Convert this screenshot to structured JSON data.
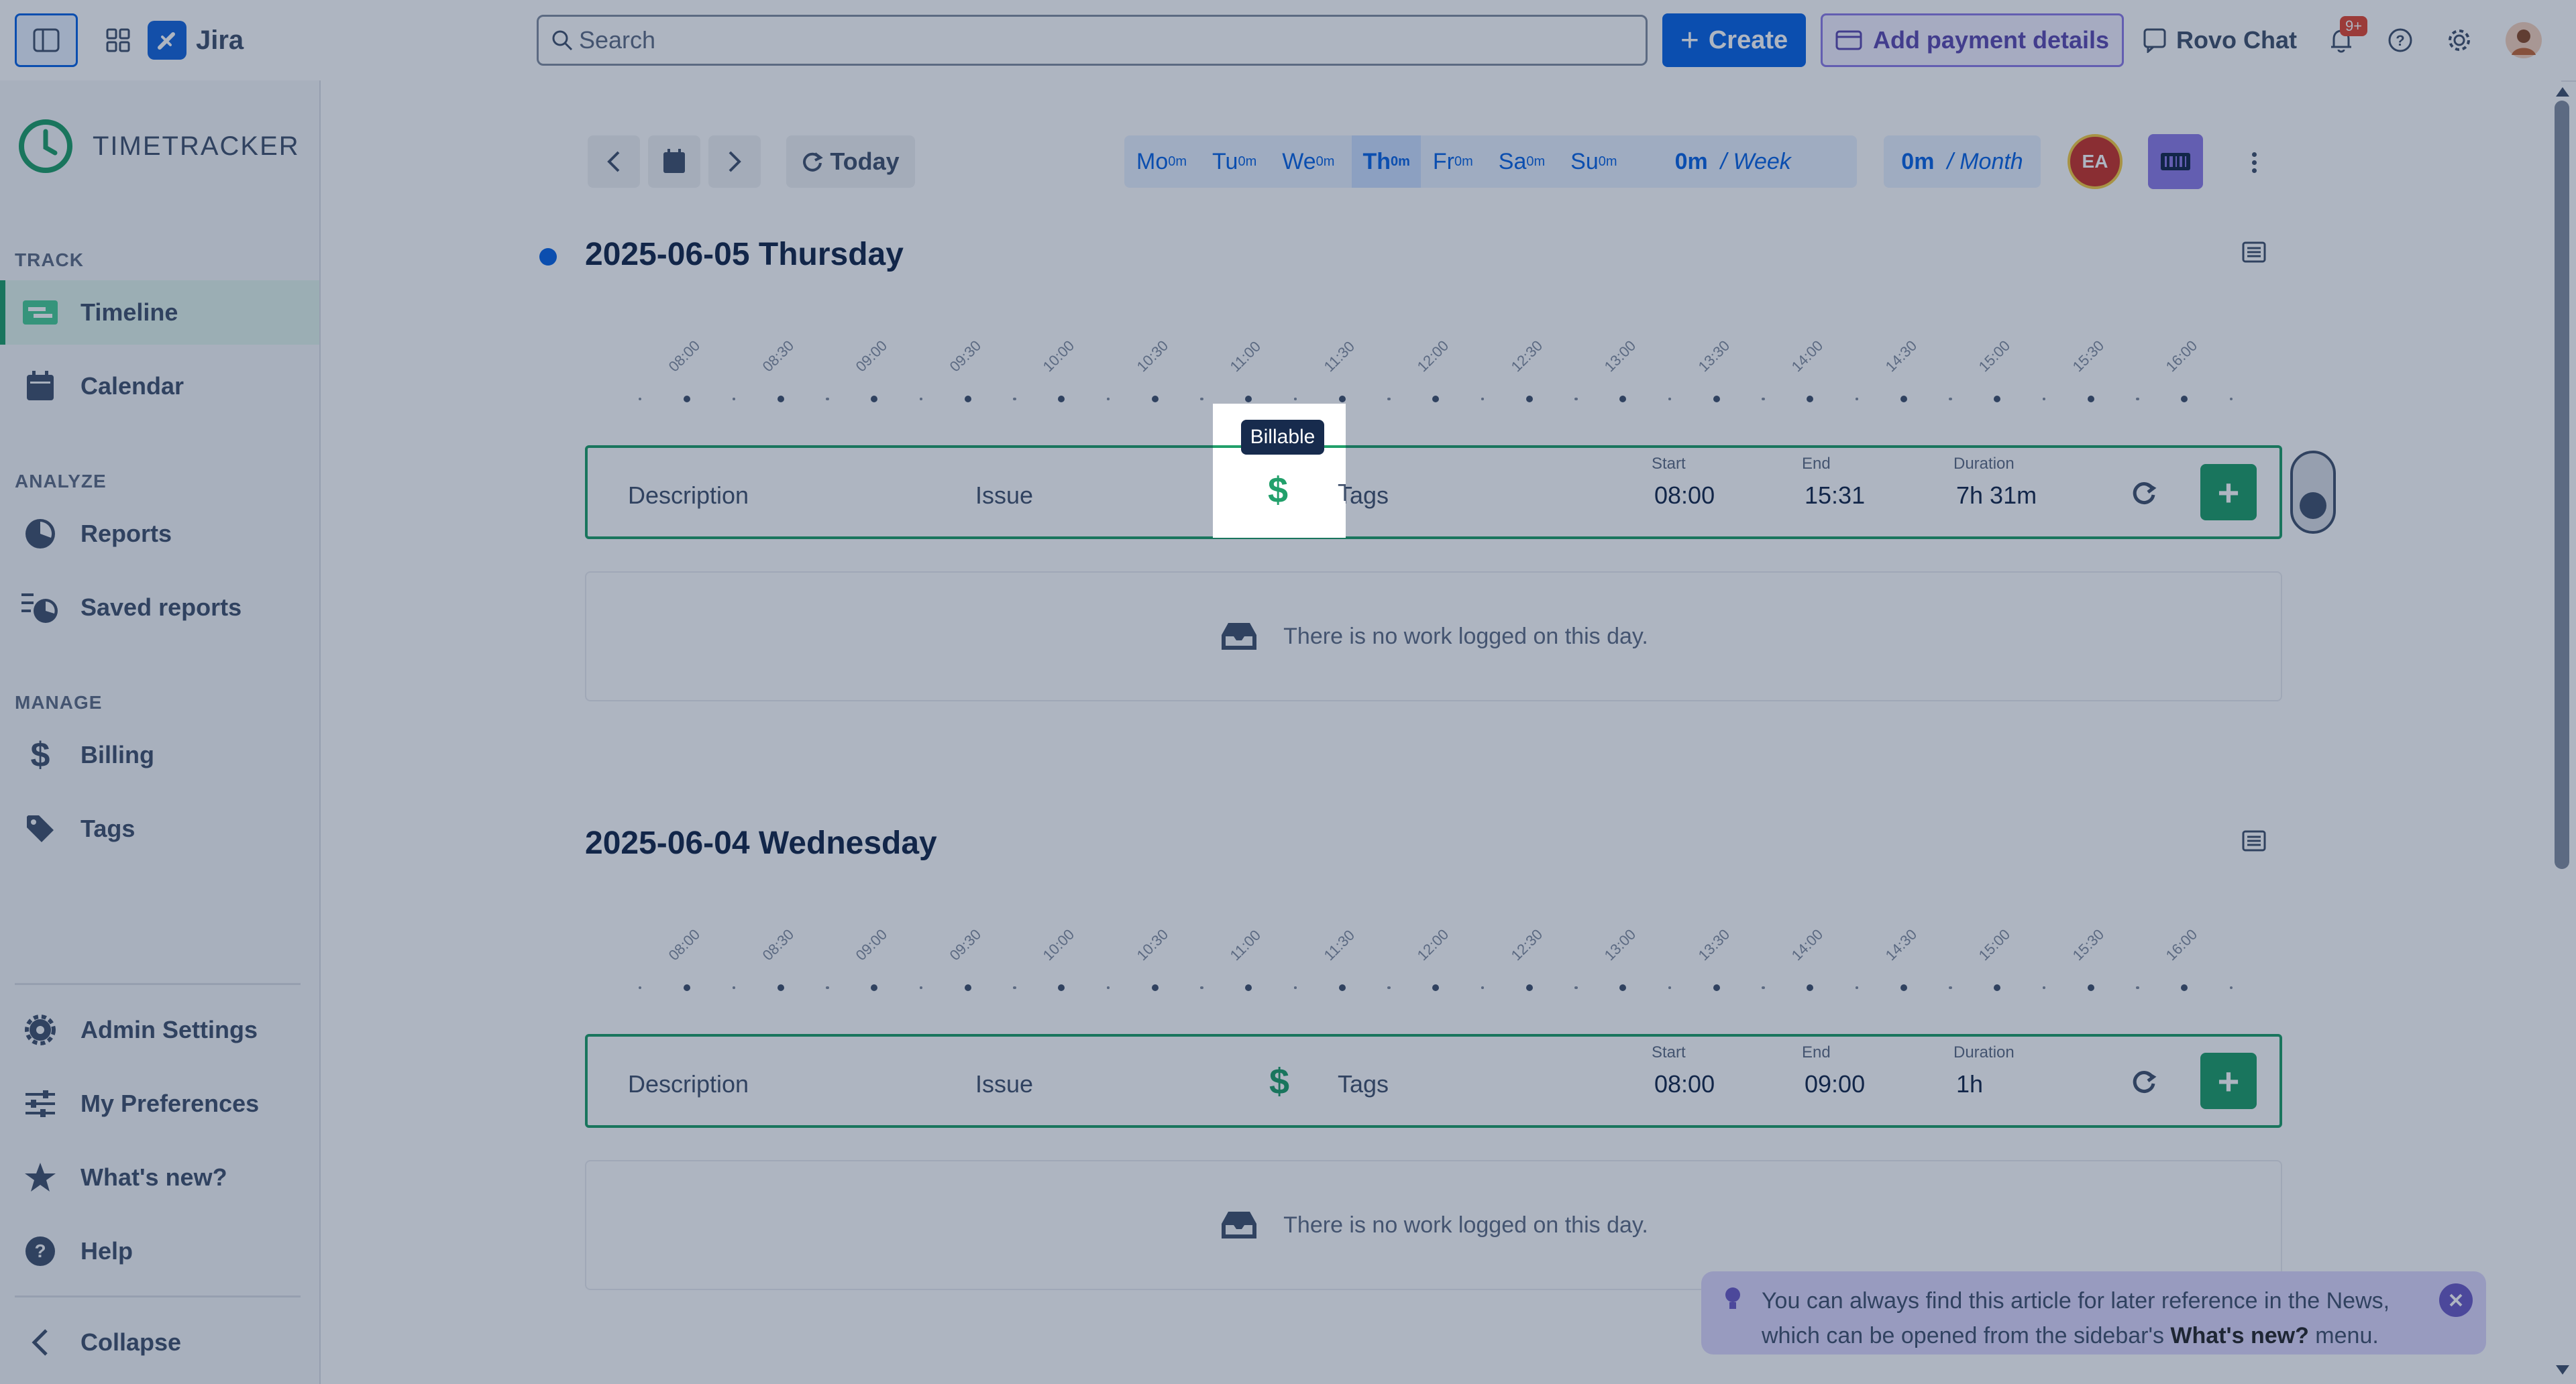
{
  "app": {
    "name": "Jira"
  },
  "search": {
    "placeholder": "Search"
  },
  "topbar": {
    "create_label": "Create",
    "payment_label": "Add payment details",
    "rovo_label": "Rovo Chat",
    "notif_badge": "9+"
  },
  "sidebar": {
    "brand": "TIMETRACKER",
    "sections": {
      "track": "TRACK",
      "analyze": "ANALYZE",
      "manage": "MANAGE"
    },
    "items": {
      "timeline": "Timeline",
      "calendar": "Calendar",
      "reports": "Reports",
      "saved_reports": "Saved reports",
      "billing": "Billing",
      "tags": "Tags",
      "admin_settings": "Admin Settings",
      "my_preferences": "My Preferences",
      "whats_new": "What's new?",
      "help": "Help",
      "collapse": "Collapse"
    }
  },
  "toolbar": {
    "today_label": "Today",
    "days": [
      {
        "label": "Mo",
        "sup": "0m"
      },
      {
        "label": "Tu",
        "sup": "0m"
      },
      {
        "label": "We",
        "sup": "0m"
      },
      {
        "label": "Th",
        "sup": "0m"
      },
      {
        "label": "Fr",
        "sup": "0m"
      },
      {
        "label": "Sa",
        "sup": "0m"
      },
      {
        "label": "Su",
        "sup": "0m"
      }
    ],
    "week_value": "0m",
    "week_unit": "/ Week",
    "month_value": "0m",
    "month_unit": "/ Month",
    "avatar_initials": "EA"
  },
  "days": [
    {
      "title": "2025-06-05 Thursday",
      "entry": {
        "description": "Description",
        "issue": "Issue",
        "tags": "Tags",
        "start_label": "Start",
        "start": "08:00",
        "end_label": "End",
        "end": "15:31",
        "duration_label": "Duration",
        "duration": "7h 31m"
      },
      "empty_text": "There is no work logged on this day."
    },
    {
      "title": "2025-06-04 Wednesday",
      "entry": {
        "description": "Description",
        "issue": "Issue",
        "tags": "Tags",
        "start_label": "Start",
        "start": "08:00",
        "end_label": "End",
        "end": "09:00",
        "duration_label": "Duration",
        "duration": "1h"
      },
      "empty_text": "There is no work logged on this day."
    }
  ],
  "timeline_ticks": [
    "08:00",
    "08:30",
    "09:00",
    "09:30",
    "10:00",
    "10:30",
    "11:00",
    "11:30",
    "12:00",
    "12:30",
    "13:00",
    "13:30",
    "14:00",
    "14:30",
    "15:00",
    "15:30",
    "16:00"
  ],
  "tooltip": {
    "text": "Billable"
  },
  "news": {
    "text_before": "You can always find this article for later reference in the News, which can be opened from the sidebar's ",
    "link": "What's new?",
    "text_after": " menu."
  }
}
